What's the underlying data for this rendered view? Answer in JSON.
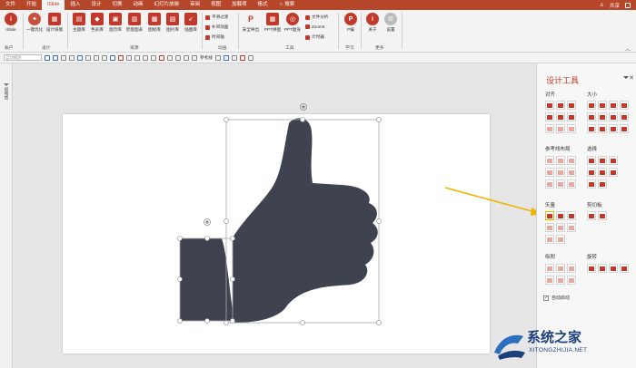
{
  "tabs": [
    "文件",
    "开始",
    "iSlide",
    "插入",
    "设计",
    "切换",
    "动画",
    "幻灯片放映",
    "审阅",
    "视图",
    "加载项",
    "格式",
    "搜索"
  ],
  "active_tab_index": 2,
  "share": "共享",
  "ribbon": {
    "islide": "iSlide",
    "account_group": "账户",
    "one_click": "一键优化",
    "design_layout": "设计排版",
    "design_group": "设计",
    "theme_lib": "主题库",
    "color_lib": "色彩库",
    "chart_lib": "图示库",
    "smart_chart": "智能图表",
    "icon_lib": "图标库",
    "picture_lib": "图片库",
    "illustration_lib": "插图库",
    "resource_group": "资源",
    "smooth_transition": "平滑过渡",
    "complement_animation": "补间动画",
    "timeline": "时间轴",
    "animation_group": "动画",
    "safe_export": "安全导出",
    "ppt_collage": "PPT拼图",
    "ppt_slim": "PPT瘦身",
    "file_analysis": "文件分析",
    "zoomit": "ZoomIt",
    "timer": "计时器",
    "tools_group": "工具",
    "p_learn": "P编",
    "learn_group": "学习",
    "about": "关于",
    "settings": "设置",
    "more_group": "更多"
  },
  "quick_toolbar": {
    "auto_size": "自动缩放",
    "guides": "参考线"
  },
  "left_pane": {
    "label": "缩略图"
  },
  "design_panel": {
    "title": "设计工具",
    "align": "对齐",
    "size": "大小",
    "guide_layout": "参考线布局",
    "select": "选择",
    "vector": "矢量",
    "clipboard": "剪切板",
    "snap": "吸附",
    "rotate": "旋转",
    "auto_start": "自动启动"
  },
  "watermark": {
    "name": "系统之家",
    "url": "XITONGZHIJIA.NET"
  },
  "colors": {
    "accent": "#b7472a",
    "icon_red": "#c0392b",
    "shape": "#3f4350",
    "arrow": "#f0b400"
  }
}
